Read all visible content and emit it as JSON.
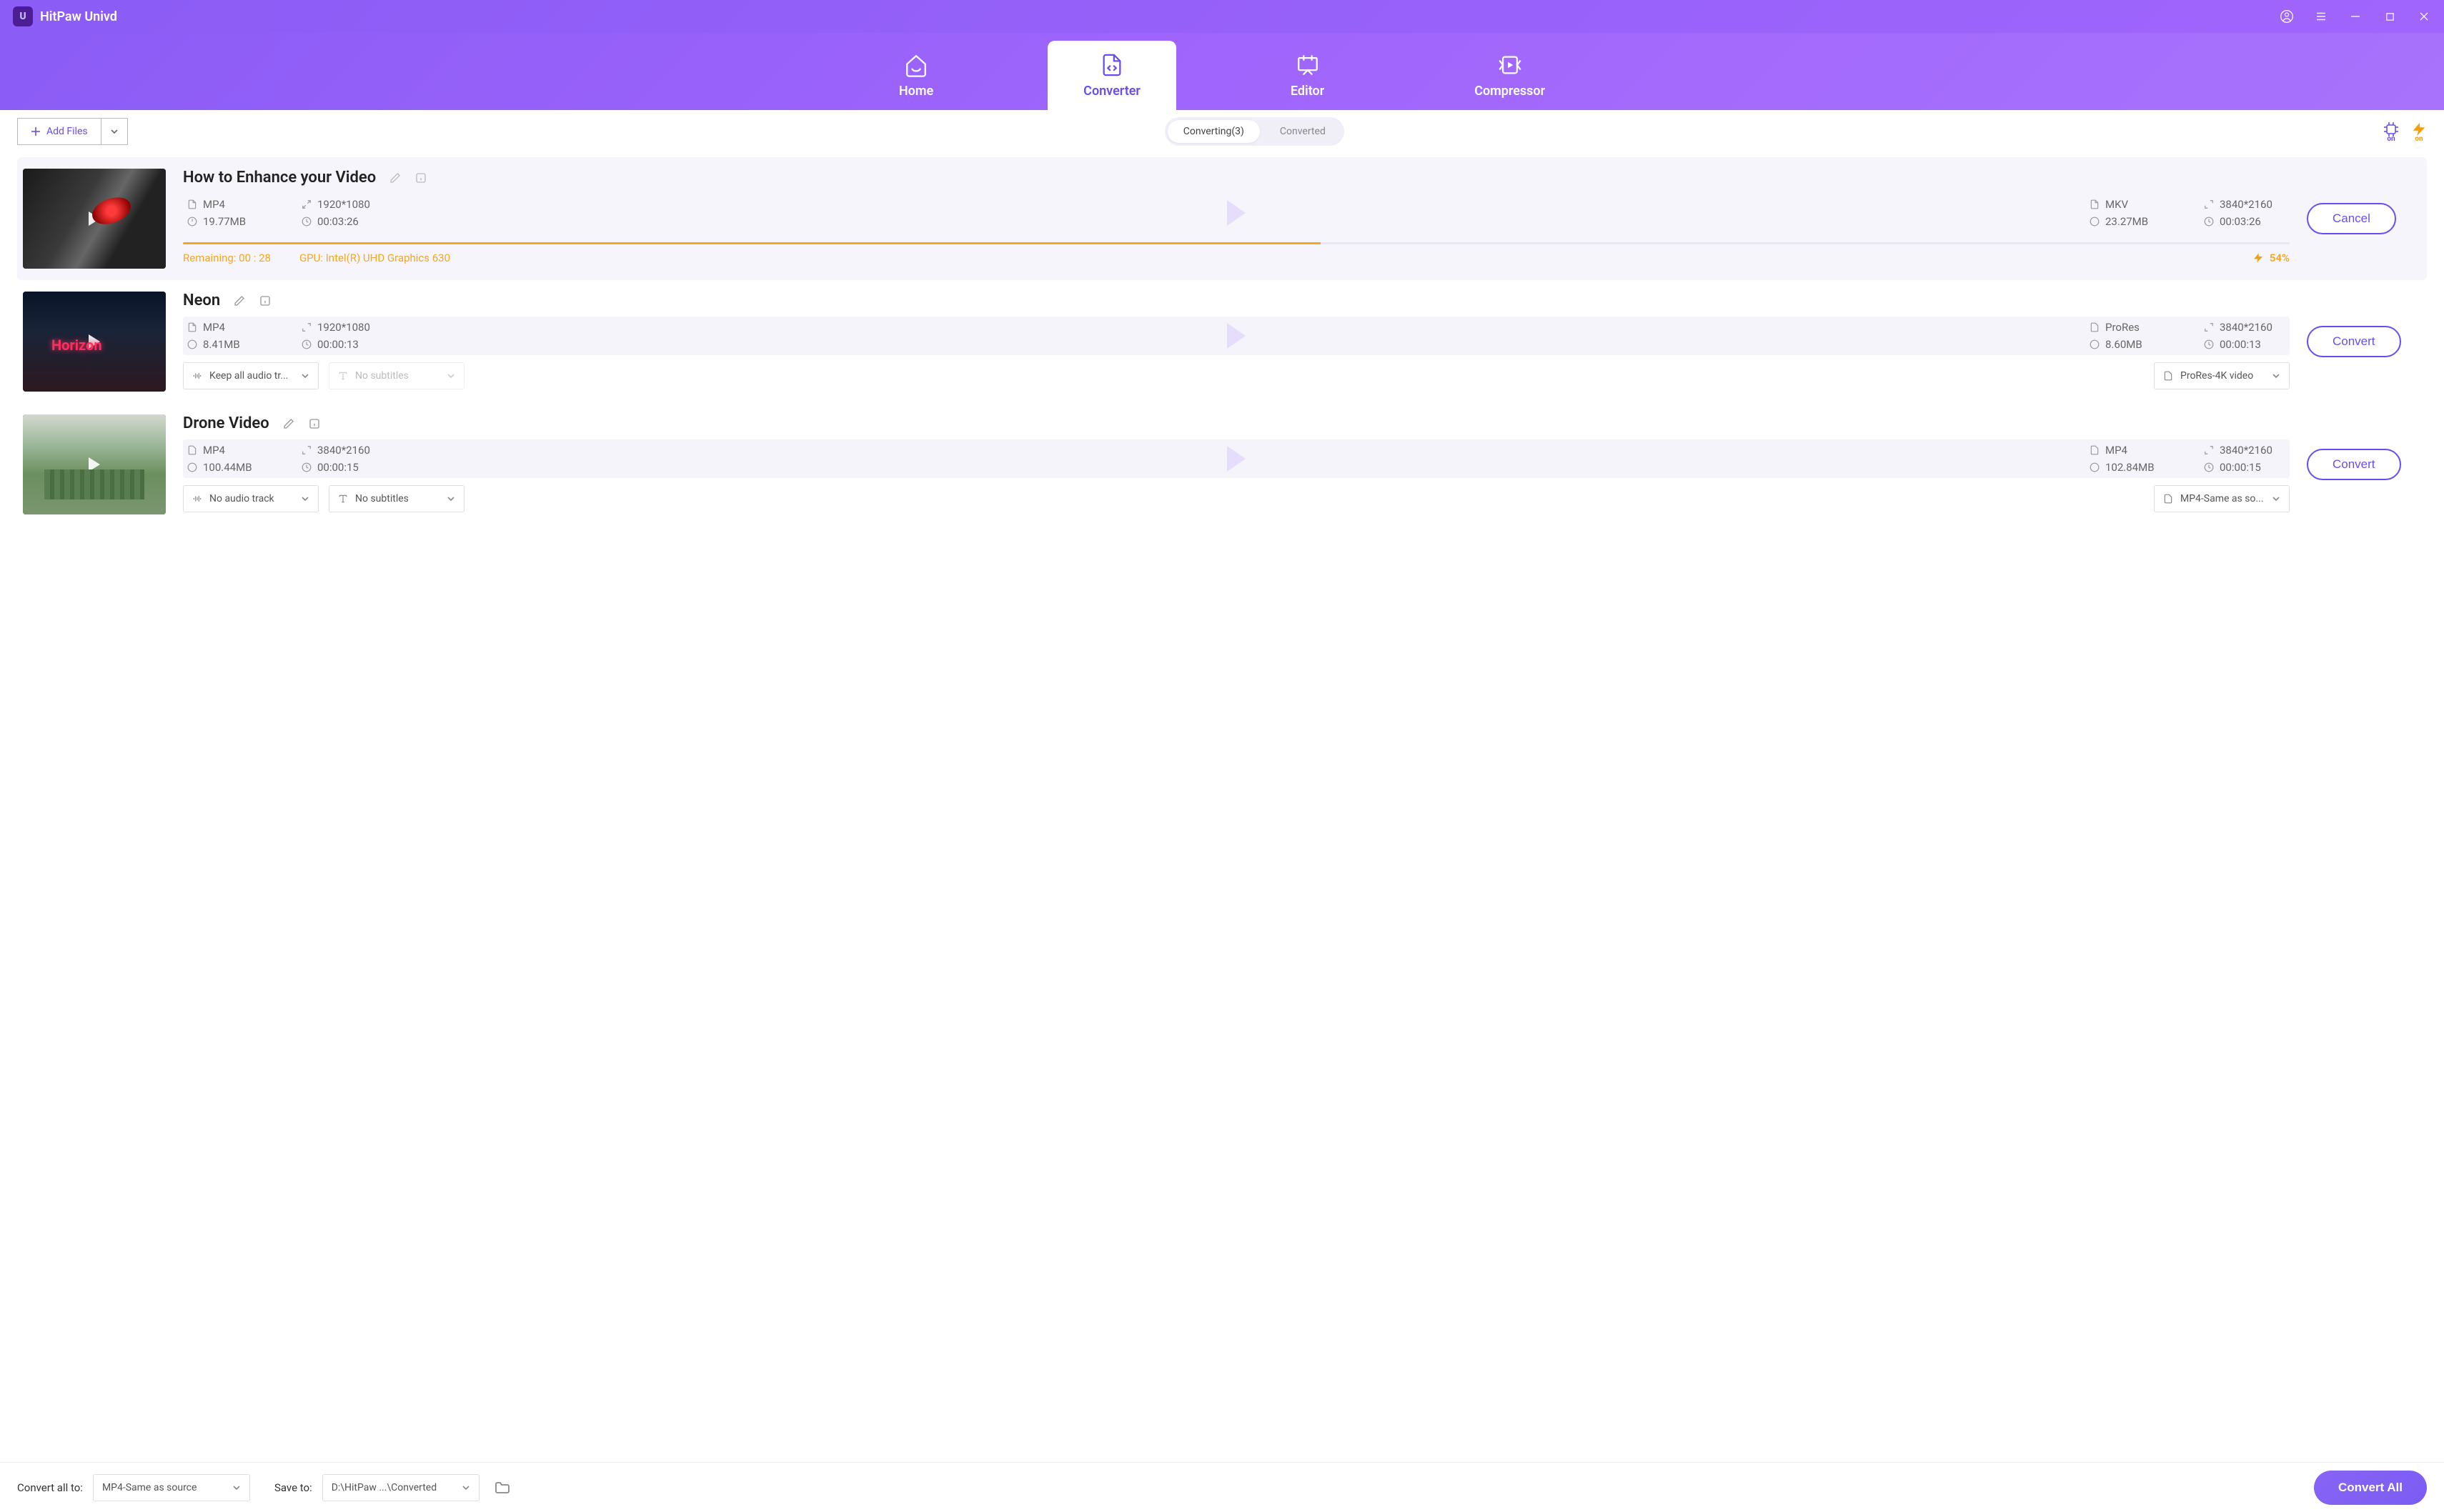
{
  "app": {
    "title": "HitPaw Univd"
  },
  "nav": {
    "home": "Home",
    "converter": "Converter",
    "editor": "Editor",
    "compressor": "Compressor"
  },
  "toolbar": {
    "addFiles": "Add Files",
    "converting": "Converting(3)",
    "converted": "Converted",
    "hwBadge": "on",
    "speedBadge": "on"
  },
  "items": [
    {
      "title": "How to Enhance your Video",
      "src": {
        "format": "MP4",
        "resolution": "1920*1080",
        "size": "19.77MB",
        "duration": "00:03:26"
      },
      "dst": {
        "format": "MKV",
        "resolution": "3840*2160",
        "size": "23.27MB",
        "duration": "00:03:26"
      },
      "converting": true,
      "progress": {
        "remaining": "Remaining: 00 : 28",
        "gpu": "GPU: Intel(R) UHD Graphics 630",
        "pct": "54%",
        "pctValue": 54
      },
      "action": "Cancel"
    },
    {
      "title": "Neon",
      "src": {
        "format": "MP4",
        "resolution": "1920*1080",
        "size": "8.41MB",
        "duration": "00:00:13"
      },
      "dst": {
        "format": "ProRes",
        "resolution": "3840*2160",
        "size": "8.60MB",
        "duration": "00:00:13"
      },
      "converting": false,
      "dropdowns": {
        "audio": "Keep all audio tr...",
        "subtitle": "No subtitles",
        "subtitleMuted": true,
        "output": "ProRes-4K video"
      },
      "action": "Convert"
    },
    {
      "title": "Drone Video",
      "src": {
        "format": "MP4",
        "resolution": "3840*2160",
        "size": "100.44MB",
        "duration": "00:00:15"
      },
      "dst": {
        "format": "MP4",
        "resolution": "3840*2160",
        "size": "102.84MB",
        "duration": "00:00:15"
      },
      "converting": false,
      "dropdowns": {
        "audio": "No audio track",
        "subtitle": "No subtitles",
        "subtitleMuted": false,
        "output": "MP4-Same as so..."
      },
      "action": "Convert"
    }
  ],
  "footer": {
    "convertAllToLabel": "Convert all to:",
    "convertAllToValue": "MP4-Same as source",
    "saveToLabel": "Save to:",
    "saveToValue": "D:\\HitPaw ...\\Converted",
    "convertAll": "Convert All"
  }
}
